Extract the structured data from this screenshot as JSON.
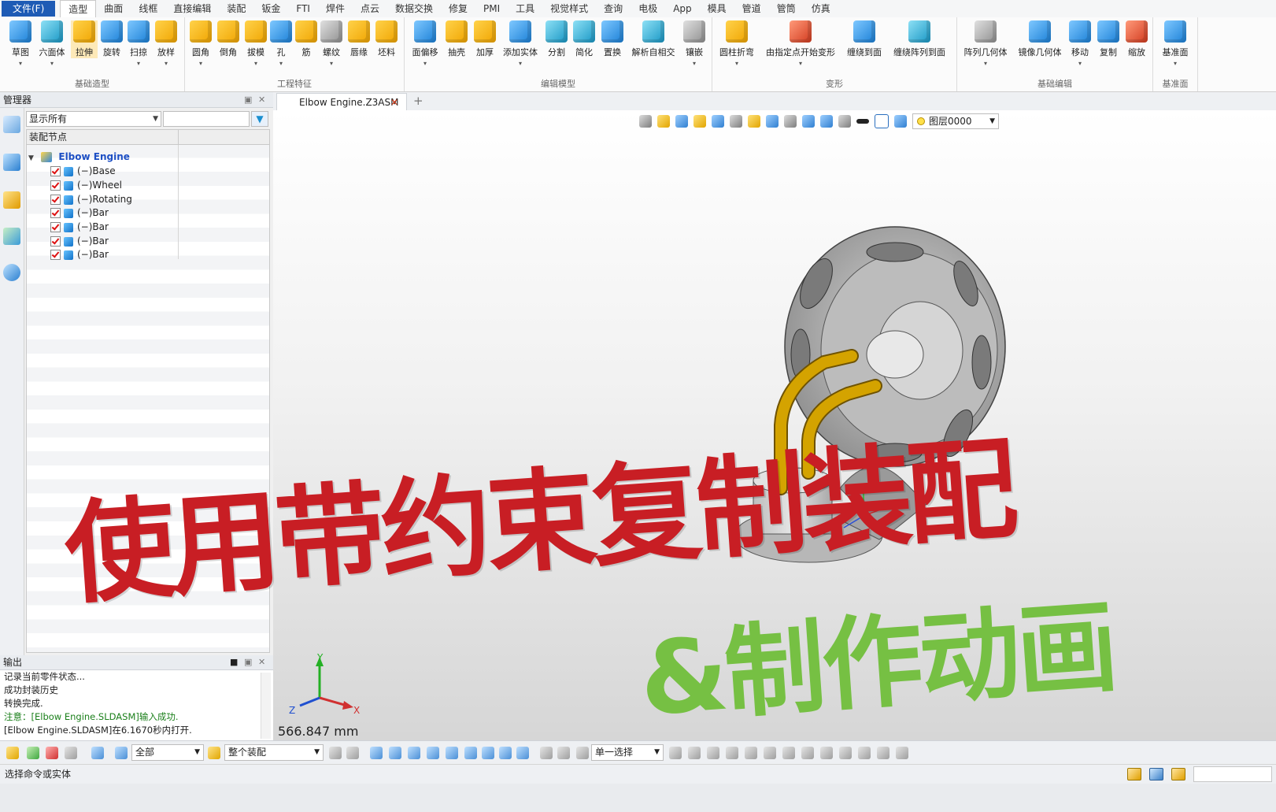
{
  "menubar": {
    "file": "文件(F)",
    "tabs": [
      "造型",
      "曲面",
      "线框",
      "直接编辑",
      "装配",
      "钣金",
      "FTI",
      "焊件",
      "点云",
      "数据交换",
      "修复",
      "PMI",
      "工具",
      "视觉样式",
      "查询",
      "电极",
      "App",
      "模具",
      "管道",
      "管筒",
      "仿真"
    ],
    "active_tab": "造型"
  },
  "ribbon": {
    "groups": [
      {
        "label": "基础造型",
        "buttons": [
          "草图",
          "六面体",
          "拉伸",
          "旋转",
          "扫掠",
          "放样"
        ]
      },
      {
        "label": "工程特征",
        "buttons": [
          "圆角",
          "倒角",
          "拔模",
          "孔",
          "筋",
          "螺纹",
          "唇缘",
          "坯料"
        ]
      },
      {
        "label": "编辑模型",
        "buttons": [
          "面偏移",
          "抽壳",
          "加厚",
          "添加实体",
          "分割",
          "简化",
          "置换",
          "解析自相交",
          "镶嵌"
        ]
      },
      {
        "label": "变形",
        "buttons": [
          "圆柱折弯",
          "由指定点开始变形",
          "缠绕到面",
          "缠绕阵列到面"
        ]
      },
      {
        "label": "基础编辑",
        "buttons": [
          "阵列几何体",
          "镜像几何体",
          "移动",
          "复制",
          "缩放"
        ]
      },
      {
        "label": "基准面",
        "buttons": [
          "基准面"
        ]
      }
    ]
  },
  "manager": {
    "title": "管理器",
    "filter_value": "显示所有",
    "tree_header": "装配节点",
    "root": "Elbow Engine",
    "items": [
      "(−)Base",
      "(−)Wheel",
      "(−)Rotating",
      "(−)Bar",
      "(−)Bar",
      "(−)Bar",
      "(−)Bar"
    ]
  },
  "output": {
    "title": "输出",
    "lines": [
      "记录当前零件状态...",
      "成功封装历史",
      "转换完成.",
      "注意：[Elbow Engine.SLDASM]输入成功.",
      "[Elbow Engine.SLDASM]在6.1670秒内打开."
    ]
  },
  "document": {
    "tab_label": "Elbow Engine.Z3ASM",
    "layer": "图层0000",
    "scale_readout": "566.847 mm"
  },
  "axes": {
    "x": "X",
    "y": "Y",
    "z": "Z"
  },
  "overlay": {
    "main_title": "使用带约束复制装配",
    "sub_title": "&制作动画"
  },
  "bottombar": {
    "filter_all": "全部",
    "scope": "整个装配",
    "select_mode": "单一选择"
  },
  "status": {
    "text": "选择命令或实体"
  },
  "colors": {
    "accent": "#1e5bb5",
    "title_red": "#c81e24",
    "title_green": "#76c043",
    "pipe_gold": "#d4a300",
    "wheel_gray": "#9c9c9c"
  }
}
